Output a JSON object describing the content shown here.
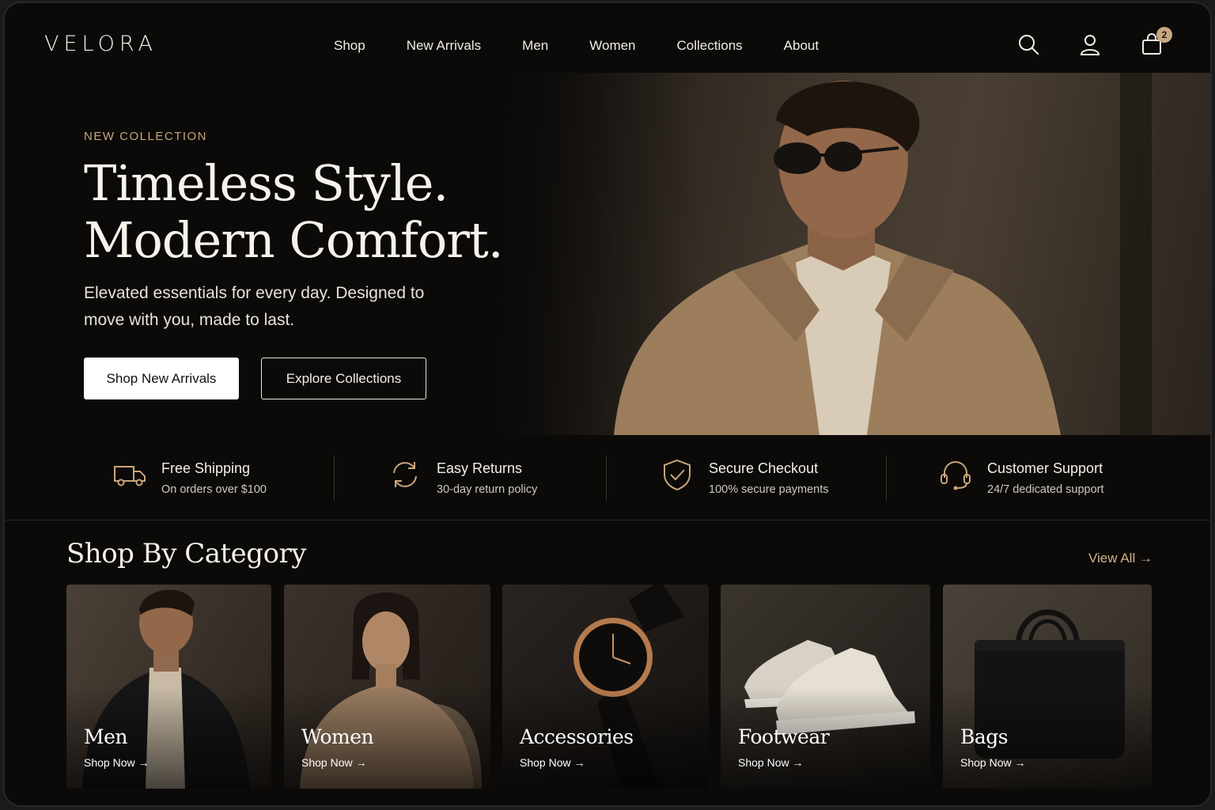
{
  "brand": {
    "logo": "VELORA"
  },
  "nav": {
    "items": [
      "Shop",
      "New Arrivals",
      "Men",
      "Women",
      "Collections",
      "About"
    ]
  },
  "header_icons": [
    "search-icon",
    "user-icon",
    "cart-icon"
  ],
  "cart": {
    "count": "2"
  },
  "hero": {
    "eyebrow": "NEW COLLECTION",
    "title_line1": "Timeless Style.",
    "title_line2": "Modern Comfort.",
    "subtitle": "Elevated essentials for every day. Designed to move with you, made to last.",
    "primary_cta": "Shop New Arrivals",
    "secondary_cta": "Explore Collections"
  },
  "features": [
    {
      "icon": "truck-icon",
      "title": "Free Shipping",
      "desc": "On orders over $100"
    },
    {
      "icon": "returns-icon",
      "title": "Easy Returns",
      "desc": "30-day return policy"
    },
    {
      "icon": "shield-check-icon",
      "title": "Secure Checkout",
      "desc": "100% secure payments"
    },
    {
      "icon": "headset-icon",
      "title": "Customer Support",
      "desc": "24/7 dedicated support"
    }
  ],
  "categories": {
    "title": "Shop By Category",
    "view_all": "View All →",
    "items": [
      {
        "name": "Men",
        "link": "Shop Now →"
      },
      {
        "name": "Women",
        "link": "Shop Now →"
      },
      {
        "name": "Accessories",
        "link": "Shop Now →"
      },
      {
        "name": "Footwear",
        "link": "Shop Now →"
      },
      {
        "name": "Bags",
        "link": "Shop Now →"
      }
    ]
  },
  "colors": {
    "accent": "#c9a57a",
    "background": "#0b0a09",
    "text": "#f3efe9"
  }
}
